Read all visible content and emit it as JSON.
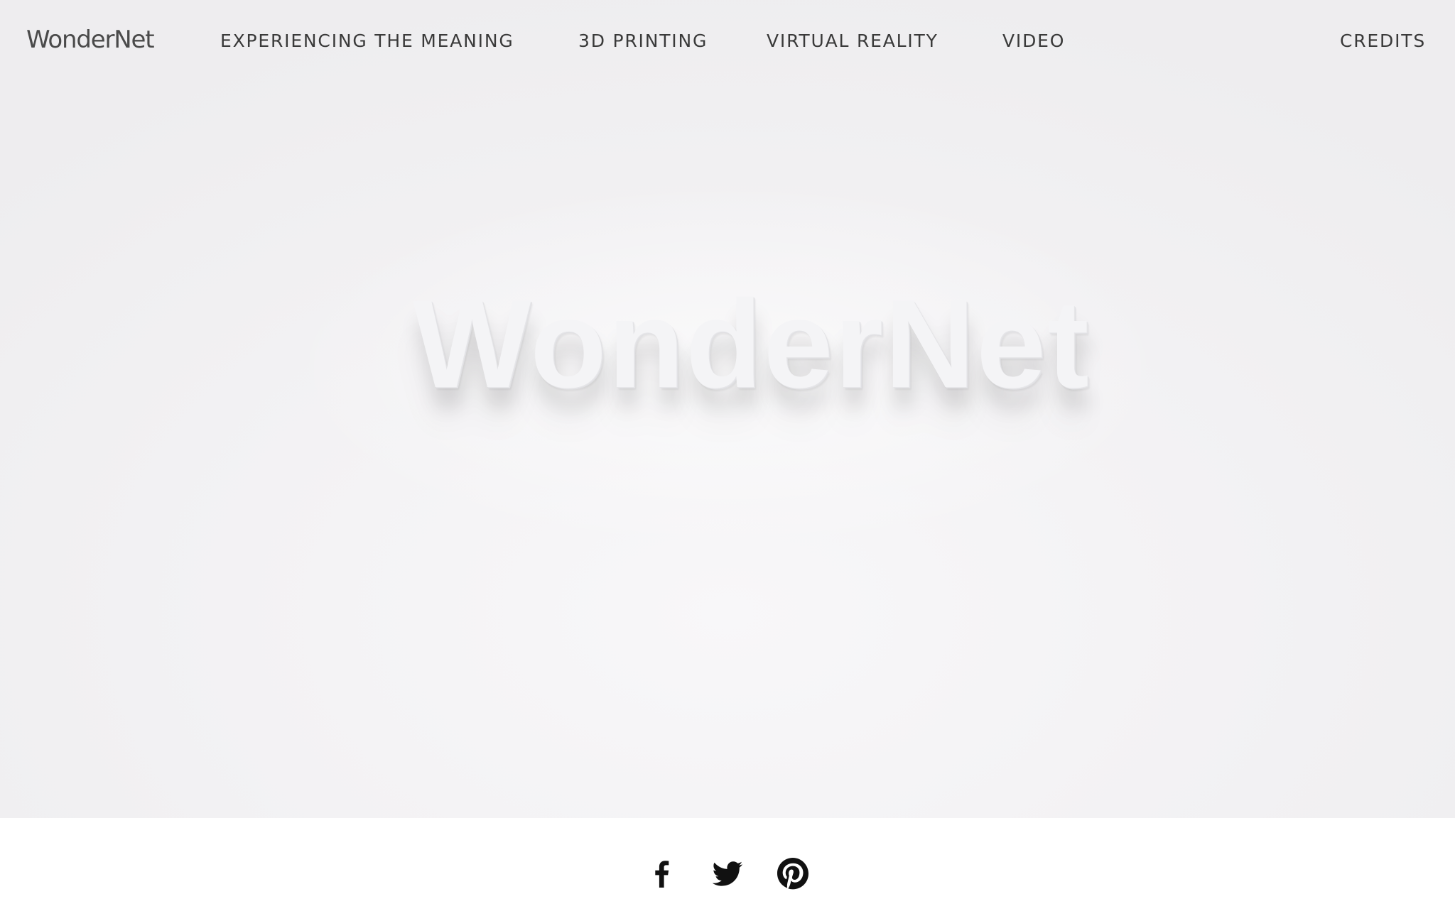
{
  "nav": {
    "brand": "WonderNet",
    "links": [
      {
        "label": "EXPERIENCING THE MEANING"
      },
      {
        "label": "3D PRINTING"
      },
      {
        "label": "VIRTUAL REALITY"
      },
      {
        "label": "VIDEO"
      }
    ],
    "credits": "CREDITS"
  },
  "hero": {
    "logo_text": "WonderNet",
    "background_color": "#f2f1f3"
  },
  "footer": {
    "social": [
      {
        "icon": "facebook-icon"
      },
      {
        "icon": "twitter-icon"
      },
      {
        "icon": "pinterest-icon"
      }
    ],
    "icon_color": "#111111"
  }
}
